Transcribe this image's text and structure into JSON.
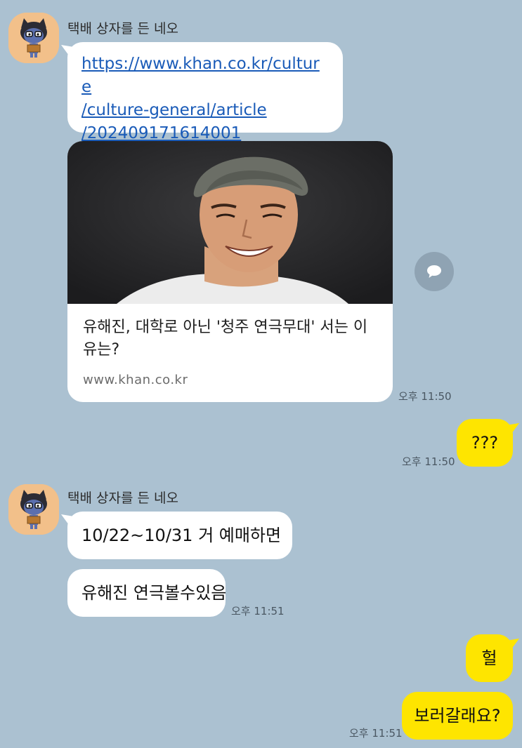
{
  "chat": {
    "group1": {
      "sender": "택배 상자를 든 네오",
      "link": "https://www.khan.co.kr/culture/culture-general/article/202409171614001",
      "link_lines": [
        "https://www.khan.co.kr/culture",
        "/culture-general/article",
        "/202409171614001"
      ],
      "card": {
        "title": "유해진, 대학로 아닌 '청주 연극무대' 서는 이유는?",
        "domain": "www.khan.co.kr"
      },
      "time": "오후 11:50"
    },
    "reply1": {
      "text": "???",
      "time": "오후 11:50"
    },
    "group2": {
      "sender": "택배 상자를 든 네오",
      "messages": [
        "10/22~10/31 거 예매하면",
        "유해진 연극볼수있음"
      ],
      "time": "오후 11:51"
    },
    "reply2": {
      "messages": [
        "헐",
        "보러갈래요?"
      ],
      "time": "오후 11:51"
    }
  },
  "colors": {
    "background": "#abc1d1",
    "my_bubble": "#fee500",
    "their_bubble": "#ffffff",
    "link": "#1a5bb8"
  },
  "icons": {
    "share": "share-speech-bubble-icon",
    "avatar": "neo-character-avatar"
  }
}
